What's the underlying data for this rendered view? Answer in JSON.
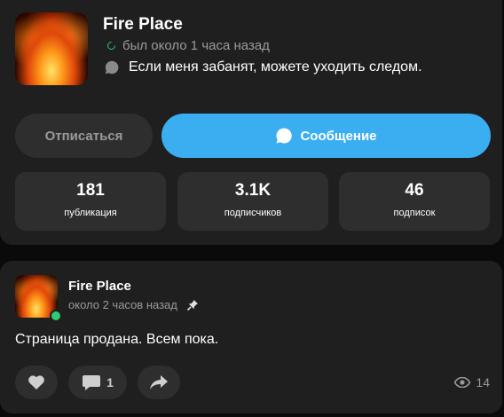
{
  "profile": {
    "name": "Fire Place",
    "status": "был около 1 часа назад",
    "bio": "Если меня забанят, можете уходить следом.",
    "unsubscribe_label": "Отписаться",
    "message_label": "Сообщение",
    "stats": [
      {
        "value": "181",
        "label": "публикация"
      },
      {
        "value": "3.1K",
        "label": "подписчиков"
      },
      {
        "value": "46",
        "label": "подписок"
      }
    ]
  },
  "post": {
    "author": "Fire Place",
    "time": "около 2 часов назад",
    "text": "Страница продана. Всем пока.",
    "comments": "1",
    "views": "14"
  },
  "colors": {
    "accent": "#3aaef0",
    "online": "#2ecc71",
    "card_bg": "#1f1f1f",
    "button_bg": "#2e2e2e"
  },
  "icons": [
    "online-status-icon",
    "speech-bubble-icon",
    "pin-icon",
    "heart-icon",
    "comment-icon",
    "share-icon",
    "eye-icon"
  ]
}
